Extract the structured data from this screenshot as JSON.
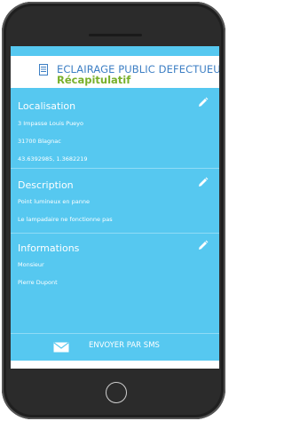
{
  "app": {
    "title": "ECLAIRAGE PUBLIC DEFECTUEUX",
    "subtitle": "Récapitulatif"
  },
  "sections": [
    {
      "title": "Localisation",
      "lines": [
        "3 Impasse Louis Pueyo",
        "31700 Blagnac",
        "43.6392985, 1.3682219"
      ],
      "edit_icon": "pencil-icon"
    },
    {
      "title": "Description",
      "lines": [
        "Point lumineux en panne",
        "Le lampadaire ne fonctionne pas"
      ],
      "edit_icon": "pencil-icon"
    },
    {
      "title": "Informations",
      "lines": [
        "Monsieur",
        "Pierre Dupont"
      ],
      "edit_icon": "pencil-icon"
    }
  ],
  "sms_button": {
    "label": "ENVOYER PAR SMS",
    "icon": "envelope-icon"
  },
  "colors": {
    "accent": "#56c8f0",
    "title": "#3d7fc4",
    "subtitle": "#79b02b",
    "phone_body": "#2b2b2b"
  }
}
